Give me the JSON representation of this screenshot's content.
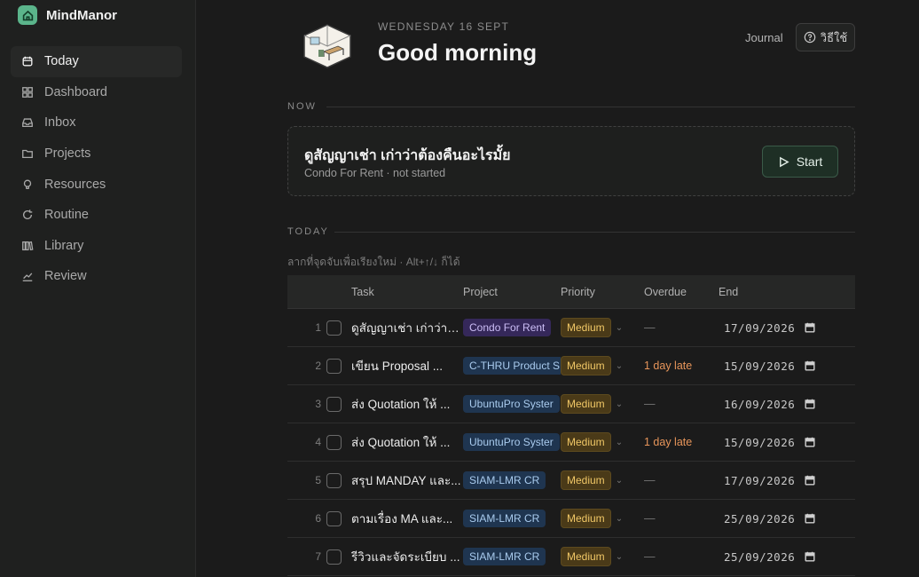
{
  "app": {
    "name": "MindManor"
  },
  "sidebar": {
    "items": [
      {
        "label": "Today",
        "icon": "calendar-icon",
        "active": true
      },
      {
        "label": "Dashboard",
        "icon": "grid-icon"
      },
      {
        "label": "Inbox",
        "icon": "inbox-icon"
      },
      {
        "label": "Projects",
        "icon": "folder-icon"
      },
      {
        "label": "Resources",
        "icon": "bulb-icon"
      },
      {
        "label": "Routine",
        "icon": "refresh-icon"
      },
      {
        "label": "Library",
        "icon": "books-icon"
      },
      {
        "label": "Review",
        "icon": "chart-icon"
      }
    ]
  },
  "header": {
    "date": "WEDNESDAY 16 SEPT",
    "greeting": "Good morning",
    "journal_label": "Journal",
    "howto_label": "วิธีใช้"
  },
  "now": {
    "section_label": "NOW",
    "task_title": "ดูสัญญาเช่า เก่าว่าต้องคืนอะไรมั้ย",
    "task_sub": "Condo For Rent · not started",
    "start_label": "Start"
  },
  "today": {
    "section_label": "TODAY",
    "hint": "ลากที่จุดจับเพื่อเรียงใหม่ · Alt+↑/↓ ก็ได้",
    "columns": {
      "task": "Task",
      "project": "Project",
      "priority": "Priority",
      "overdue": "Overdue",
      "end": "End"
    },
    "rows": [
      {
        "num": "1",
        "task": "ดูสัญญาเช่า เก่าว่าต้องคืนอะไรมั้ย",
        "project": "Condo For Rent",
        "tag": "purple",
        "priority": "Medium",
        "overdue": "—",
        "end": "17/09/2026"
      },
      {
        "num": "2",
        "task": "เขียน Proposal ...",
        "project": "C-THRU Product S",
        "tag": "blue",
        "priority": "Medium",
        "overdue": "1 day late",
        "end": "15/09/2026"
      },
      {
        "num": "3",
        "task": "ส่ง Quotation ให้ ...",
        "project": "UbuntuPro Syster",
        "tag": "blue",
        "priority": "Medium",
        "overdue": "—",
        "end": "16/09/2026"
      },
      {
        "num": "4",
        "task": "ส่ง Quotation ให้ ...",
        "project": "UbuntuPro Syster",
        "tag": "blue",
        "priority": "Medium",
        "overdue": "1 day late",
        "end": "15/09/2026"
      },
      {
        "num": "5",
        "task": "สรุป MANDAY และ...",
        "project": "SIAM-LMR CR",
        "tag": "blue",
        "priority": "Medium",
        "overdue": "—",
        "end": "17/09/2026"
      },
      {
        "num": "6",
        "task": "ตามเรื่อง MA และ...",
        "project": "SIAM-LMR CR",
        "tag": "blue",
        "priority": "Medium",
        "overdue": "—",
        "end": "25/09/2026"
      },
      {
        "num": "7",
        "task": "รีวิวและจัดระเบียบ ...",
        "project": "SIAM-LMR CR",
        "tag": "blue",
        "priority": "Medium",
        "overdue": "—",
        "end": "25/09/2026"
      }
    ]
  },
  "colors": {
    "accent": "#5bb58b",
    "late": "#e7955a",
    "priority": "#f0c766"
  }
}
